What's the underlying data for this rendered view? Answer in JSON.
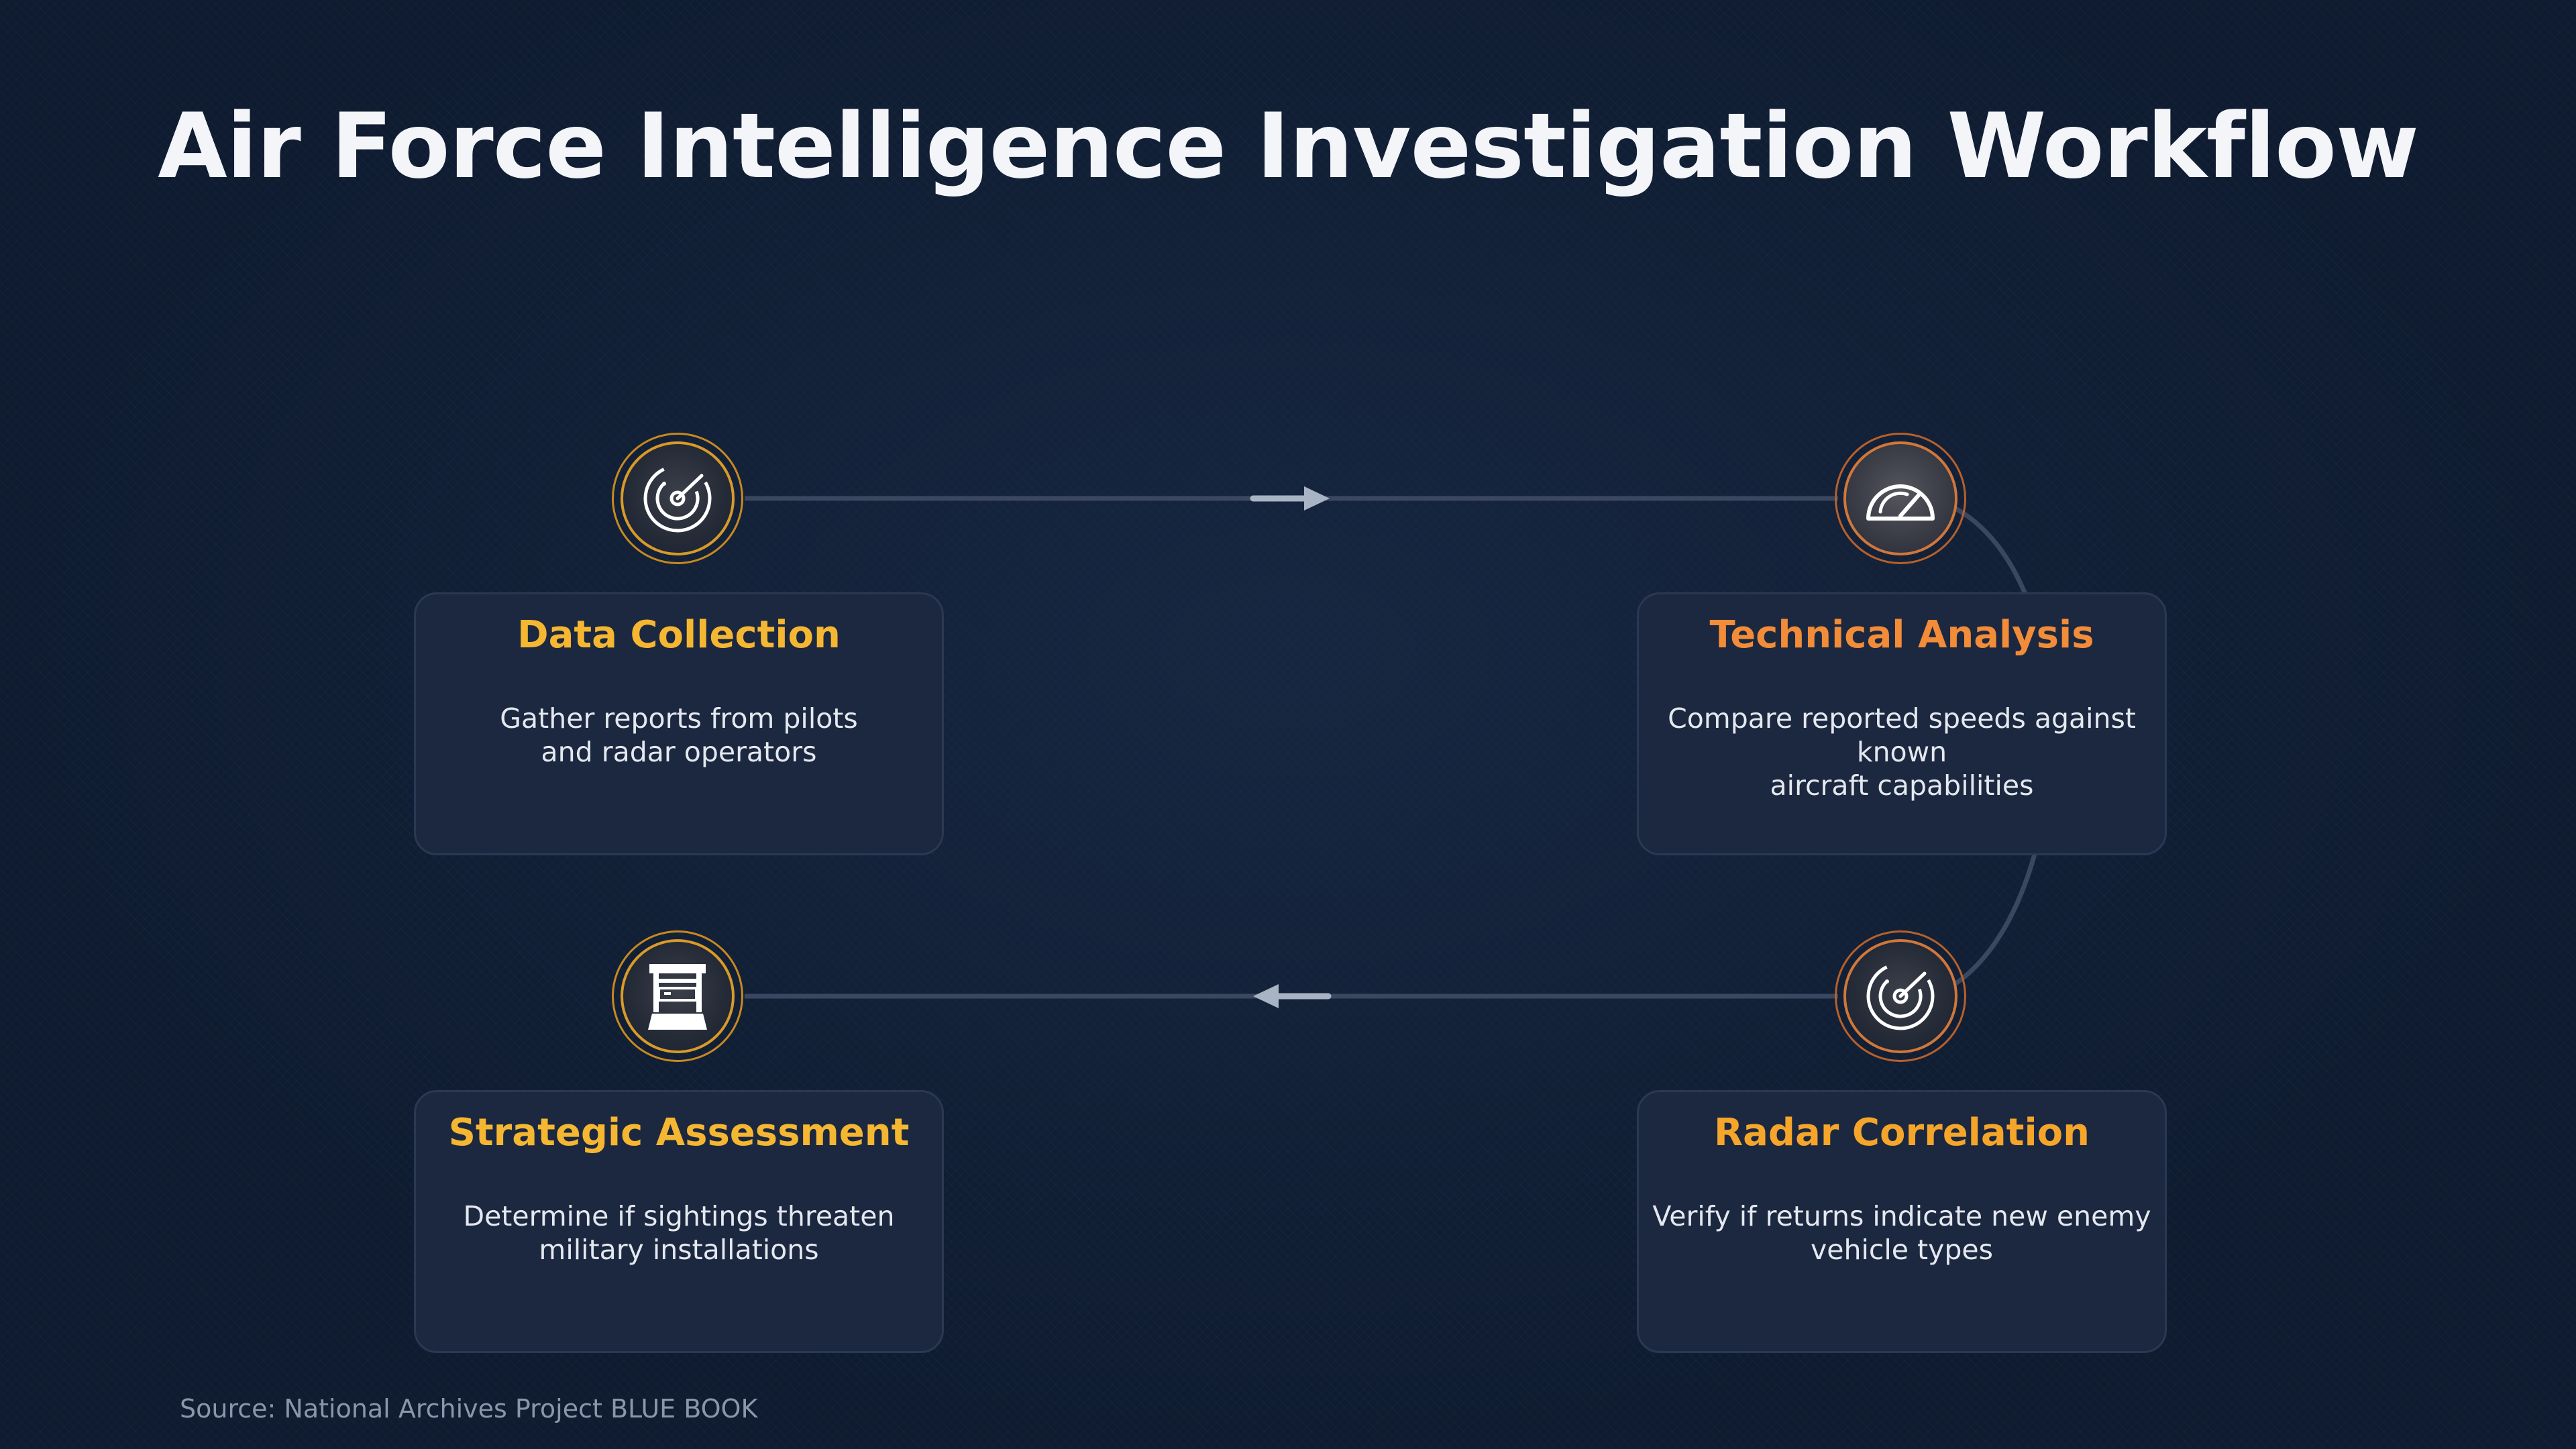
{
  "title": "Air Force Intelligence Investigation Workflow",
  "steps": [
    {
      "heading": "Data Collection",
      "description": "Gather reports from pilots\nand radar operators",
      "icon": "radar-icon",
      "color": "#f5b731"
    },
    {
      "heading": "Technical Analysis",
      "description": "Compare reported speeds against known\naircraft capabilities",
      "icon": "speedometer-icon",
      "color": "#f28c38"
    },
    {
      "heading": "Radar Correlation",
      "description": "Verify if returns indicate new enemy\nvehicle types",
      "icon": "radar-icon",
      "color": "#f5a62a"
    },
    {
      "heading": "Strategic Assessment",
      "description": "Determine if sightings threaten\nmilitary installations",
      "icon": "archive-cabinet-icon",
      "color": "#f5b731"
    }
  ],
  "source": "Source: National Archives Project BLUE BOOK",
  "colors": {
    "background": "#0e1b30",
    "card": "#1c2840",
    "connector": "#3b4760",
    "arrow": "#a8b3c4"
  }
}
